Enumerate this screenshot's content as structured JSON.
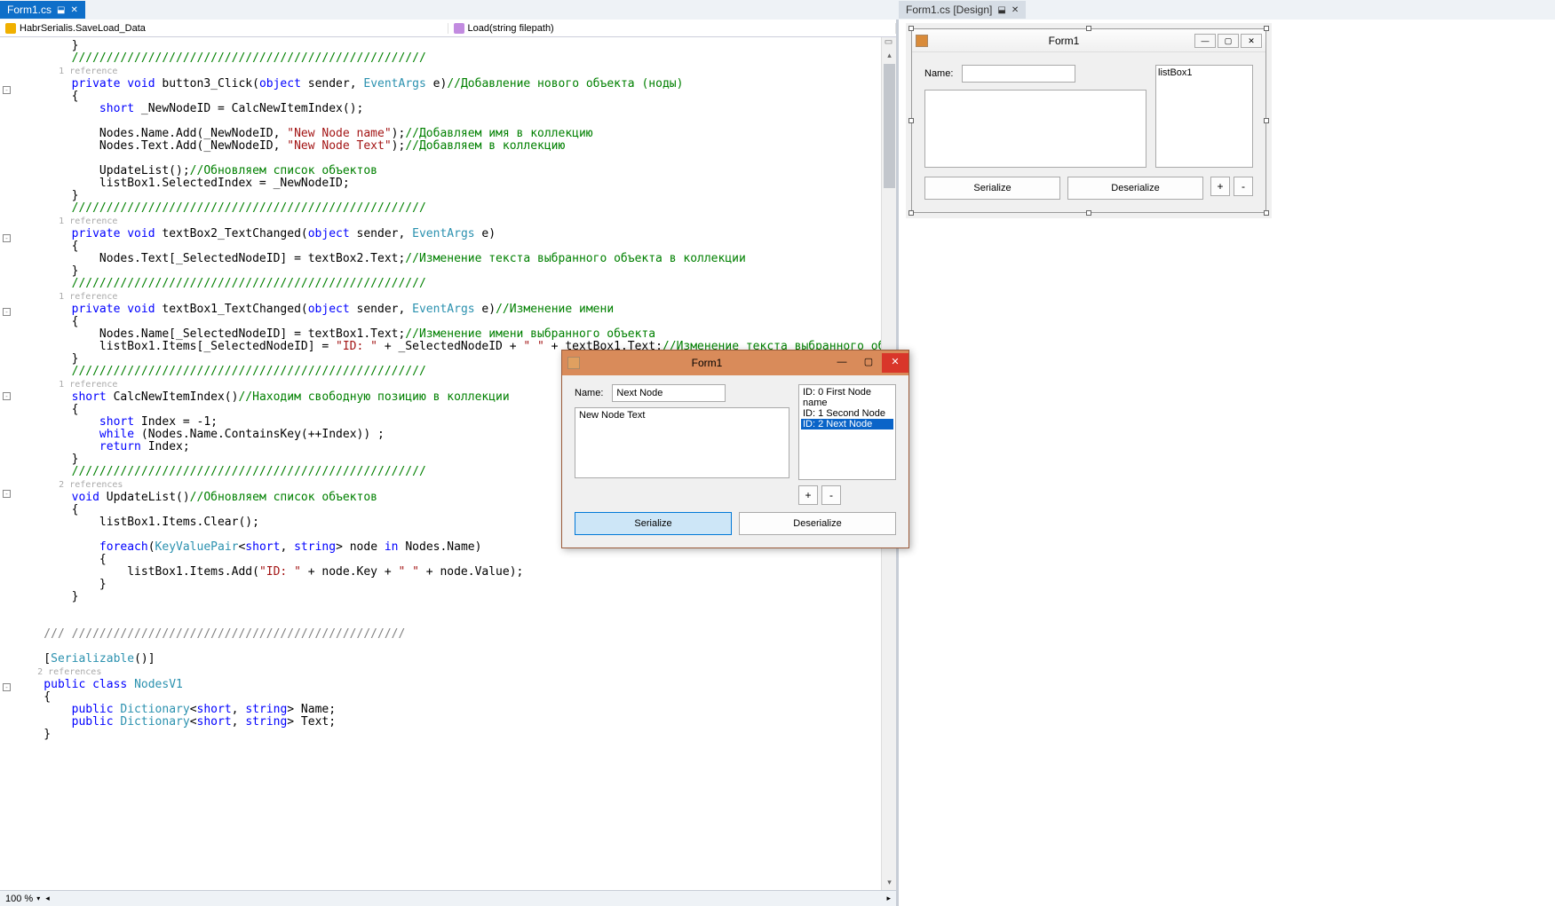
{
  "tabs": {
    "code": {
      "label": "Form1.cs",
      "pin": "⬓",
      "close": "✕"
    },
    "design": {
      "label": "Form1.cs [Design]",
      "pin": "⬓",
      "close": "✕"
    }
  },
  "breadcrumb": {
    "left": "HabrSerialis.SaveLoad_Data",
    "right": "Load(string filepath)"
  },
  "refs": {
    "one": "1 reference",
    "two": "2 references"
  },
  "code": {
    "l1": "        }",
    "l2": "        ///////////////////////////////////////////////////",
    "l3_a": "        private void",
    "l3_b": " button3_Click(",
    "l3_c": "object",
    "l3_d": " sender, ",
    "l3_e": "EventArgs",
    "l3_f": " e)",
    "l3_g": "//Добавление нового объекта (ноды)",
    "l4": "        {",
    "l5_a": "            short",
    "l5_b": " _NewNodeID = CalcNewItemIndex();",
    "l7_a": "            Nodes.Name.Add(_NewNodeID, ",
    "l7_b": "\"New Node name\"",
    "l7_c": ");",
    "l7_d": "//Добавляем имя в коллекцию",
    "l8_a": "            Nodes.Text.Add(_NewNodeID, ",
    "l8_b": "\"New Node Text\"",
    "l8_c": ");",
    "l8_d": "//Добавляем в коллекцию",
    "l10_a": "            UpdateList();",
    "l10_b": "//Обновляем список объектов",
    "l11": "            listBox1.SelectedIndex = _NewNodeID;",
    "l12": "        }",
    "l13": "        ///////////////////////////////////////////////////",
    "l14_a": "        private void",
    "l14_b": " textBox2_TextChanged(",
    "l14_c": "object",
    "l14_d": " sender, ",
    "l14_e": "EventArgs",
    "l14_f": " e)",
    "l15": "        {",
    "l16_a": "            Nodes.Text[_SelectedNodeID] = textBox2.Text;",
    "l16_b": "//Изменение текста выбранного объекта в коллекции",
    "l17": "        }",
    "l18": "        ///////////////////////////////////////////////////",
    "l19_a": "        private void",
    "l19_b": " textBox1_TextChanged(",
    "l19_c": "object",
    "l19_d": " sender, ",
    "l19_e": "EventArgs",
    "l19_f": " e)",
    "l19_g": "//Изменение имени",
    "l20": "        {",
    "l21_a": "            Nodes.Name[_SelectedNodeID] = textBox1.Text;",
    "l21_b": "//Изменение имени выбранного объекта",
    "l22_a": "            listBox1.Items[_SelectedNodeID] = ",
    "l22_b": "\"ID: \"",
    "l22_c": " + _SelectedNodeID + ",
    "l22_d": "\" \"",
    "l22_e": " + textBox1.Text;",
    "l22_f": "//Изменение текста выбранного объекта в списке",
    "l23": "        }",
    "l24": "        ///////////////////////////////////////////////////",
    "l25_a": "        short",
    "l25_b": " CalcNewItemIndex()",
    "l25_c": "//Находим свободную позицию в коллекции",
    "l26": "        {",
    "l27_a": "            short",
    "l27_b": " Index = -1;",
    "l28_a": "            while",
    "l28_b": " (Nodes.Name.ContainsKey(++Index)) ;",
    "l29_a": "            return",
    "l29_b": " Index;",
    "l30": "        }",
    "l31": "        ///////////////////////////////////////////////////",
    "l32_a": "        void",
    "l32_b": " UpdateList()",
    "l32_c": "//Обновляем список объектов",
    "l33": "        {",
    "l34": "            listBox1.Items.Clear();",
    "l36_a": "            foreach",
    "l36_b": "(",
    "l36_c": "KeyValuePair",
    "l36_d": "<",
    "l36_e": "short",
    "l36_f": ", ",
    "l36_g": "string",
    "l36_h": "> node ",
    "l36_i": "in",
    "l36_j": " Nodes.Name)",
    "l37": "            {",
    "l38_a": "                listBox1.Items.Add(",
    "l38_b": "\"ID: \"",
    "l38_c": " + node.Key + ",
    "l38_d": "\" \"",
    "l38_e": " + node.Value);",
    "l39": "            }",
    "l40": "        }",
    "l43": "    /// ////////////////////////////////////////////////",
    "l45_a": "    [",
    "l45_b": "Serializable",
    "l45_c": "()]",
    "l46_a": "    public class ",
    "l46_b": "NodesV1",
    "l47": "    {",
    "l48_a": "        public ",
    "l48_b": "Dictionary",
    "l48_c": "<",
    "l48_d": "short",
    "l48_e": ", ",
    "l48_f": "string",
    "l48_g": "> Name;",
    "l49_a": "        public ",
    "l49_b": "Dictionary",
    "l49_c": "<",
    "l49_d": "short",
    "l49_e": ", ",
    "l49_f": "string",
    "l49_g": "> Text;",
    "l50": "    }"
  },
  "zoom": "100 %",
  "designer": {
    "title": "Form1",
    "name_label": "Name:",
    "listbox_placeholder": "listBox1",
    "serialize": "Serialize",
    "deserialize": "Deserialize",
    "plus": "+",
    "minus": "-"
  },
  "runapp": {
    "title": "Form1",
    "name_label": "Name:",
    "name_value": "Next Node",
    "text_value": "New Node Text",
    "items": [
      "ID: 0 First Node name",
      "ID: 1 Second Node",
      "ID: 2 Next Node"
    ],
    "serialize": "Serialize",
    "deserialize": "Deserialize",
    "plus": "+",
    "minus": "-"
  }
}
